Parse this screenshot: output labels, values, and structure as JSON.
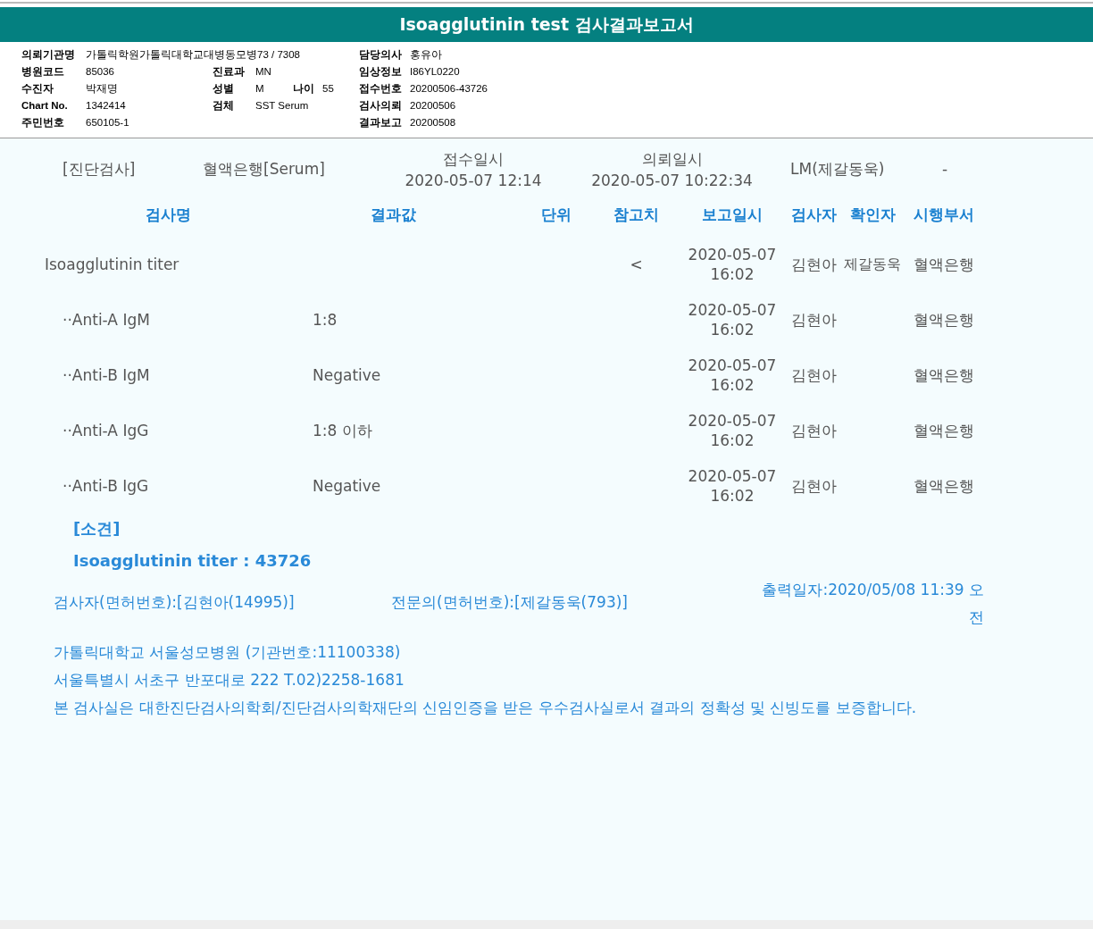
{
  "title": "Isoagglutinin test 검사결과보고서",
  "header_info": [
    {
      "left": {
        "label": "의뢰기관명",
        "value": "가톨릭학원가톨릭대학교대병동모병73 / 7308"
      },
      "right": {
        "label": "담당의사",
        "value": "홍유아"
      }
    },
    {
      "left": {
        "label": "병원코드",
        "value": "85036"
      },
      "middle": [
        {
          "label": "진료과",
          "value": "MN"
        }
      ],
      "right": {
        "label": "임상정보",
        "value": "I86YL0220"
      }
    },
    {
      "left": {
        "label": "수진자",
        "value": "박재명"
      },
      "middle": [
        {
          "label": "성별",
          "value": "M"
        },
        {
          "label": "나이",
          "value": "55"
        }
      ],
      "right": {
        "label": "접수번호",
        "value": "20200506-43726"
      }
    },
    {
      "left": {
        "label": "Chart No.",
        "value": "1342414"
      },
      "middle": [
        {
          "label": "검체",
          "value": "SST Serum"
        }
      ],
      "right": {
        "label": "검사의뢰",
        "value": "20200506"
      }
    },
    {
      "left": {
        "label": "주민번호",
        "value": "650105-1"
      },
      "right": {
        "label": "결과보고",
        "value": "20200508"
      }
    }
  ],
  "order": {
    "category": "[진단검사]",
    "department": "혈액은행[Serum]",
    "received": {
      "label": "접수일시",
      "value": "2020-05-07 12:14"
    },
    "requested": {
      "label": "의뢰일시",
      "value": "2020-05-07 10:22:34"
    },
    "physician": "LM(제갈동욱)",
    "status": "-"
  },
  "table": {
    "columns": [
      "검사명",
      "결과값",
      "단위",
      "참고치",
      "보고일시",
      "검사자",
      "확인자",
      "시행부서"
    ],
    "rows": [
      {
        "name": "Isoagglutinin titer",
        "reference": "<",
        "report_date": "2020-05-07",
        "report_time": "16:02",
        "tester": "김현아",
        "confirmer": "제갈동욱",
        "dept": "혈액은행",
        "child": false
      },
      {
        "name": "··Anti-A IgM",
        "result": "1:8",
        "report_date": "2020-05-07",
        "report_time": "16:02",
        "tester": "김현아",
        "dept": "혈액은행",
        "child": true
      },
      {
        "name": "··Anti-B IgM",
        "result": "Negative",
        "report_date": "2020-05-07",
        "report_time": "16:02",
        "tester": "김현아",
        "dept": "혈액은행",
        "child": true
      },
      {
        "name": "··Anti-A IgG",
        "result": "1:8 이하",
        "report_date": "2020-05-07",
        "report_time": "16:02",
        "tester": "김현아",
        "dept": "혈액은행",
        "child": true
      },
      {
        "name": "··Anti-B IgG",
        "result": "Negative",
        "report_date": "2020-05-07",
        "report_time": "16:02",
        "tester": "김현아",
        "dept": "혈액은행",
        "child": true
      }
    ]
  },
  "findings": {
    "heading": "[소견]",
    "text": "Isoagglutinin titer : 43726"
  },
  "signatures": {
    "tester": "검사자(면허번호):[김현아(14995)]",
    "specialist": "전문의(면허번호):[제갈동욱(793)]",
    "printed": "출력일자:2020/05/08 11:39 오전"
  },
  "footer": [
    "가톨릭대학교 서울성모병원 (기관번호:11100338)",
    "서울특별시 서초구 반포대로 222 T.02)2258-1681",
    "본 검사실은 대한진단검사의학회/진단검사의학재단의 신임인증을 받은 우수검사실로서 결과의 정확성 및 신빙도를 보증합니다."
  ]
}
